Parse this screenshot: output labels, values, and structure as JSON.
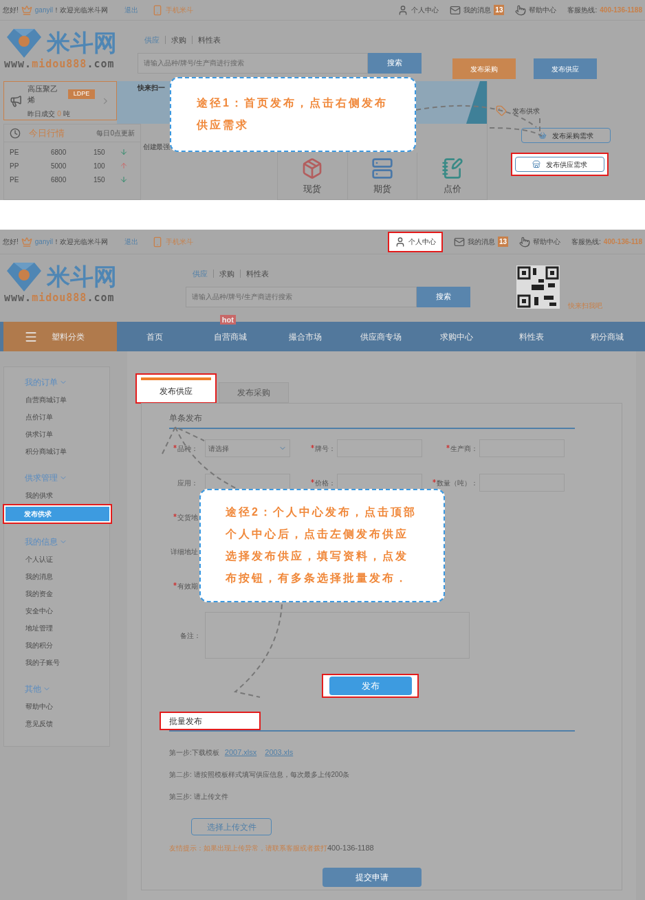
{
  "panel_1": {
    "top_bar": {
      "greeting": "您好!",
      "user": "ganyil",
      "welcome": "！欢迎光临米斗网",
      "logout": "退出",
      "mobile": "手机米斗",
      "links": [
        {
          "kind": "user",
          "label": "个人中心",
          "highlighted": false
        },
        {
          "kind": "mail",
          "label": "我的消息",
          "badge": "13",
          "highlighted": false
        },
        {
          "kind": "help",
          "label": "帮助中心",
          "highlighted": false
        }
      ],
      "hotline_label": "客服热线:",
      "hotline": "400-136-1188"
    },
    "logo": {
      "name": "米斗网",
      "url_prefix": "www.",
      "url_main": "midou888",
      "url_suffix": ".com"
    },
    "search_tabs": [
      {
        "label": "供应",
        "selected": true
      },
      {
        "label": "求购",
        "selected": false
      },
      {
        "label": "料性表",
        "selected": false
      }
    ],
    "search": {
      "placeholder": "请输入品种/牌号/生产商进行搜索",
      "button": "搜索"
    },
    "actions": [
      {
        "kind": "purchase",
        "label": "发布采购"
      },
      {
        "kind": "supply",
        "label": "发布供应"
      }
    ],
    "product": {
      "name": "高压聚乙烯",
      "tag": "LDPE",
      "deal_label": "昨日成交",
      "deal_value": "0",
      "deal_unit": "吨"
    },
    "banner": {
      "text": "快来扫一"
    },
    "market": {
      "title": "今日行情",
      "note": "每日0点更新",
      "rows": [
        {
          "name": "PE",
          "price": "6800",
          "qty": "150",
          "rising": false
        },
        {
          "name": "PP",
          "price": "5000",
          "qty": "100",
          "rising": true
        },
        {
          "name": "PE",
          "price": "6800",
          "qty": "150",
          "rising": false
        }
      ]
    },
    "promo_text": "创建最强",
    "services": [
      {
        "kind": "spot",
        "label": "现货"
      },
      {
        "kind": "futures",
        "label": "期货"
      },
      {
        "kind": "quote",
        "label": "点价"
      }
    ],
    "publish": {
      "title": "发布供求",
      "buttons": [
        {
          "kind": "purchase",
          "label": "发布采购需求",
          "highlighted": false
        },
        {
          "kind": "supply",
          "label": "发布供应需求",
          "highlighted": true
        }
      ]
    },
    "callout": [
      "途径1：首页发布，点击右侧发布",
      "供应需求"
    ]
  },
  "panel_2": {
    "top_bar": {
      "greeting": "您好!",
      "user": "ganyil",
      "welcome": "！欢迎光临米斗网",
      "logout": "退出",
      "mobile": "手机米斗",
      "links": [
        {
          "kind": "user",
          "label": "个人中心",
          "highlighted": true
        },
        {
          "kind": "mail",
          "label": "我的消息",
          "badge": "13",
          "highlighted": false
        },
        {
          "kind": "help",
          "label": "帮助中心",
          "highlighted": false
        }
      ],
      "hotline_label": "客服热线:",
      "hotline": "400-136-118"
    },
    "logo": {
      "name": "米斗网",
      "url_prefix": "www.",
      "url_main": "midou888",
      "url_suffix": ".com"
    },
    "search_tabs": [
      {
        "label": "供应",
        "selected": true
      },
      {
        "label": "求购",
        "selected": false
      },
      {
        "label": "料性表",
        "selected": false
      }
    ],
    "search": {
      "placeholder": "请输入品种/牌号/生产商进行搜索",
      "button": "搜索"
    },
    "qr_caption": "快来扫我吧",
    "nav": {
      "category": "塑料分类",
      "items": [
        {
          "label": "首页"
        },
        {
          "label": "自营商城",
          "badge": "hot"
        },
        {
          "label": "撮合市场"
        },
        {
          "label": "供应商专场"
        },
        {
          "label": "求购中心"
        },
        {
          "label": "料性表"
        },
        {
          "label": "积分商城"
        }
      ]
    },
    "sidebar": [
      {
        "title": "我的订单",
        "items": [
          {
            "label": "自营商城订单",
            "selected": false
          },
          {
            "label": "点价订单",
            "selected": false
          },
          {
            "label": "供求订单",
            "selected": false
          },
          {
            "label": "积分商城订单",
            "selected": false
          }
        ]
      },
      {
        "title": "供求管理",
        "items": [
          {
            "label": "我的供求",
            "selected": false
          },
          {
            "label": "发布供求",
            "selected": true
          }
        ]
      },
      {
        "title": "我的信息",
        "items": [
          {
            "label": "个人认证",
            "selected": false
          },
          {
            "label": "我的消息",
            "selected": false
          },
          {
            "label": "我的资金",
            "selected": false
          },
          {
            "label": "安全中心",
            "selected": false
          },
          {
            "label": "地址管理",
            "selected": false
          },
          {
            "label": "我的积分",
            "selected": false
          },
          {
            "label": "我的子账号",
            "selected": false
          }
        ]
      },
      {
        "title": "其他",
        "items": [
          {
            "label": "帮助中心",
            "selected": false
          },
          {
            "label": "意见反馈",
            "selected": false
          }
        ]
      }
    ],
    "tabs": [
      {
        "label": "发布供应",
        "selected": true,
        "highlighted": true
      },
      {
        "label": "发布采购",
        "selected": false,
        "highlighted": false
      }
    ],
    "single": {
      "title": "单条发布",
      "rows": [
        {
          "fields": [
            {
              "label": "品种：",
              "required": true,
              "kind": "select",
              "value": "请选择"
            },
            {
              "label": "牌号：",
              "required": true,
              "kind": "text"
            },
            {
              "label": "生产商：",
              "required": true,
              "kind": "text"
            }
          ]
        },
        {
          "fields": [
            {
              "label": "应用：",
              "required": false,
              "kind": "text"
            },
            {
              "label": "价格：",
              "required": true,
              "kind": "text"
            },
            {
              "label": "数量（吨）：",
              "required": true,
              "kind": "text"
            }
          ]
        },
        {
          "fields": [
            {
              "label": "交货地",
              "required": true
            }
          ]
        },
        {
          "fields": [
            {
              "label": "详细地址",
              "required": false
            }
          ]
        },
        {
          "fields": [
            {
              "label": "有效期",
              "required": true
            }
          ]
        }
      ],
      "note": {
        "label": "备注：",
        "required": false,
        "kind": "textarea"
      },
      "submit": {
        "label": "发布",
        "highlighted": true
      }
    },
    "batch": {
      "title": "批量发布",
      "highlighted": true,
      "steps": [
        {
          "text": "第一步:下载模板",
          "links": [
            "2007.xlsx",
            "2003.xls"
          ]
        },
        {
          "text": "第二步: 请按照模板样式填写供应信息，每次最多上传200条"
        },
        {
          "text": "第三步: 请上传文件"
        }
      ],
      "upload": "选择上传文件",
      "tip": "友情提示：如果出现上传异常，请联系客服或者拨打",
      "tip_phone": "400-136-1188",
      "apply": "提交申请"
    },
    "callout": [
      "途径2：个人中心发布，点击顶部",
      "个人中心后，点击左侧发布供应",
      "选择发布供应，填写资料，点发",
      "布按钮，有多条选择批量发布．"
    ]
  }
}
